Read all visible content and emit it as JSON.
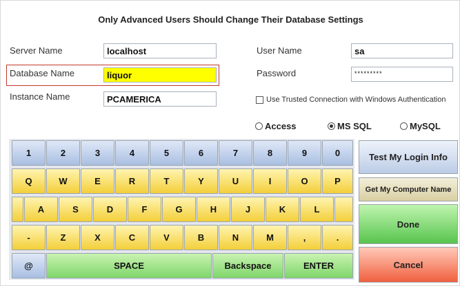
{
  "title": "Only Advanced Users Should Change Their Database Settings",
  "fields": {
    "server_name": {
      "label": "Server Name",
      "value": "localhost"
    },
    "database_name": {
      "label": "Database Name",
      "value": "liquor"
    },
    "instance_name": {
      "label": "Instance Name",
      "value": "PCAMERICA"
    },
    "user_name": {
      "label": "User Name",
      "value": "sa"
    },
    "password": {
      "label": "Password",
      "value": "*********"
    }
  },
  "trusted_connection": {
    "label": "Use Trusted Connection with Windows Authentication",
    "checked": false
  },
  "db_types": [
    {
      "label": "Access",
      "selected": false
    },
    {
      "label": "MS SQL",
      "selected": true
    },
    {
      "label": "MySQL",
      "selected": false
    }
  ],
  "keyboard": {
    "row1": [
      "1",
      "2",
      "3",
      "4",
      "5",
      "6",
      "7",
      "8",
      "9",
      "0"
    ],
    "row2": [
      "Q",
      "W",
      "E",
      "R",
      "T",
      "Y",
      "U",
      "I",
      "O",
      "P"
    ],
    "row3": [
      "A",
      "S",
      "D",
      "F",
      "G",
      "H",
      "J",
      "K",
      "L"
    ],
    "row4": [
      "-",
      "Z",
      "X",
      "C",
      "V",
      "B",
      "N",
      "M",
      ",",
      "."
    ],
    "row5": {
      "at": "@",
      "space": "SPACE",
      "backspace": "Backspace",
      "enter": "ENTER"
    }
  },
  "buttons": {
    "test_login": "Test My Login Info",
    "get_computer_name": "Get My Computer Name",
    "done": "Done",
    "cancel": "Cancel"
  },
  "colors": {
    "highlight": "#ffff00",
    "number_keys": "#a9bfe2",
    "letter_keys": "#f3cf3a",
    "action_keys": "#7fd66a",
    "done": "#58c44d",
    "cancel": "#f0603f",
    "outline": "#c0392b"
  }
}
